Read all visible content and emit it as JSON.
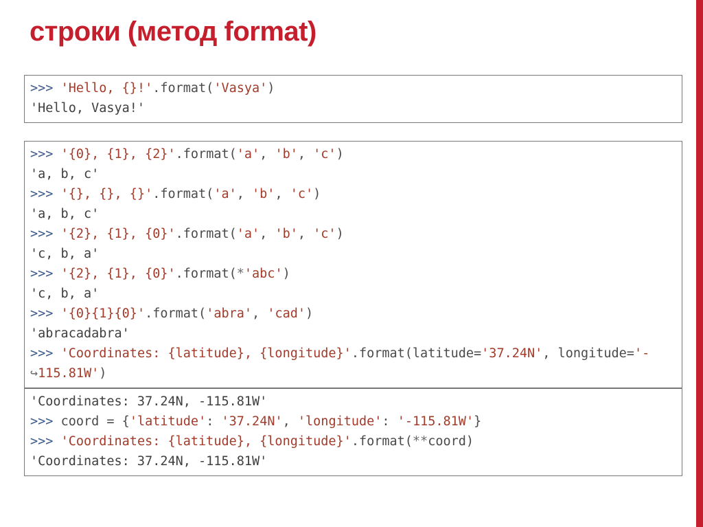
{
  "title": "строки (метод format)",
  "box1": {
    "l1_prompt": ">>> ",
    "l1_str": "'Hello, {}!'",
    "l1_mid": ".format(",
    "l1_arg": "'Vasya'",
    "l1_end": ")",
    "l2": "'Hello, Vasya!'"
  },
  "box2": {
    "l1_prompt": ">>> ",
    "l1_str": "'{0}, {1}, {2}'",
    "l1_mid": ".format(",
    "l1_a": "'a'",
    "l1_c1": ", ",
    "l1_b": "'b'",
    "l1_c2": ", ",
    "l1_cc": "'c'",
    "l1_end": ")",
    "l2": "'a, b, c'",
    "l3_prompt": ">>> ",
    "l3_str": "'{}, {}, {}'",
    "l3_mid": ".format(",
    "l3_a": "'a'",
    "l3_c1": ", ",
    "l3_b": "'b'",
    "l3_c2": ", ",
    "l3_cc": "'c'",
    "l3_end": ")",
    "l4": "'a, b, c'",
    "l5_prompt": ">>> ",
    "l5_str": "'{2}, {1}, {0}'",
    "l5_mid": ".format(",
    "l5_a": "'a'",
    "l5_c1": ", ",
    "l5_b": "'b'",
    "l5_c2": ", ",
    "l5_cc": "'c'",
    "l5_end": ")",
    "l6": "'c, b, a'",
    "l7_prompt": ">>> ",
    "l7_str": "'{2}, {1}, {0}'",
    "l7_mid": ".format(",
    "l7_star": "*",
    "l7_arg": "'abc'",
    "l7_end": ")",
    "l8": "'c, b, a'",
    "l9_prompt": ">>> ",
    "l9_str": "'{0}{1}{0}'",
    "l9_mid": ".format(",
    "l9_a": "'abra'",
    "l9_c1": ", ",
    "l9_b": "'cad'",
    "l9_end": ")",
    "l10": "'abracadabra'",
    "l11_prompt": ">>> ",
    "l11_str": "'Coordinates: {latitude}, {longitude}'",
    "l11_mid": ".format(latitude=",
    "l11_a": "'37.24N'",
    "l11_c1": ", longitude=",
    "l11_b": "'-",
    "l12_cont": "↪",
    "l12_b": "115.81W'",
    "l12_end": ")"
  },
  "box3": {
    "l1": "'Coordinates: 37.24N, -115.81W'",
    "l2_prompt": ">>> ",
    "l2_ident": "coord",
    "l2_eq": " = {",
    "l2_k1": "'latitude'",
    "l2_col1": ": ",
    "l2_v1": "'37.24N'",
    "l2_c": ", ",
    "l2_k2": "'longitude'",
    "l2_col2": ": ",
    "l2_v2": "'-115.81W'",
    "l2_end": "}",
    "l3_prompt": ">>> ",
    "l3_str": "'Coordinates: {latitude}, {longitude}'",
    "l3_mid": ".format(",
    "l3_star": "**",
    "l3_arg": "coord",
    "l3_end": ")",
    "l4": "'Coordinates: 37.24N, -115.81W'"
  }
}
